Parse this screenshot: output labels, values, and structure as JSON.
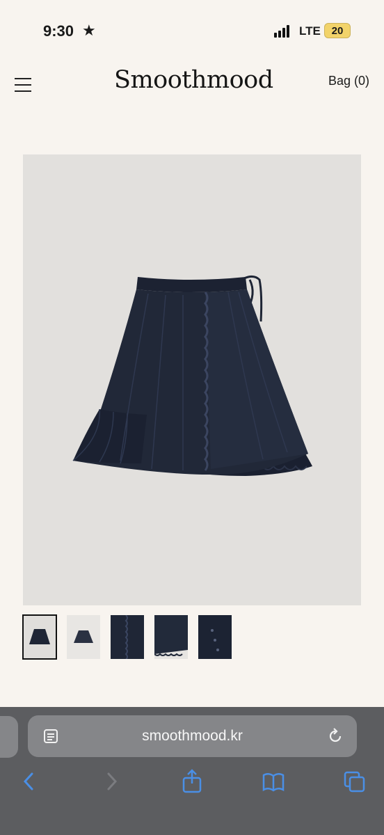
{
  "status_bar": {
    "time": "9:30",
    "focus_glyph": "★",
    "network": "LTE",
    "battery": "20"
  },
  "header": {
    "logo": "Smoothmood",
    "bag_label": "Bag (0)",
    "menu_icon": "hamburger-menu-icon"
  },
  "product": {
    "main_image": "navy-ruffle-wrap-skirt",
    "thumbnails": [
      "skirt-front-dark",
      "skirt-front-light",
      "skirt-ruffle-detail",
      "skirt-hem-detail",
      "skirt-button-detail"
    ],
    "active_thumbnail": 0
  },
  "browser": {
    "url": "smoothmood.kr",
    "icons": [
      "reader-icon",
      "reload-icon",
      "back-icon",
      "forward-icon",
      "share-icon",
      "bookmarks-icon",
      "tabs-icon"
    ]
  },
  "colors": {
    "page_bg": "#f8f4ef",
    "image_bg": "#e2e0dd",
    "skirt": "#1e2535",
    "safari_toolbar": "#5c5d60",
    "safari_accent": "#4a8fe6"
  }
}
